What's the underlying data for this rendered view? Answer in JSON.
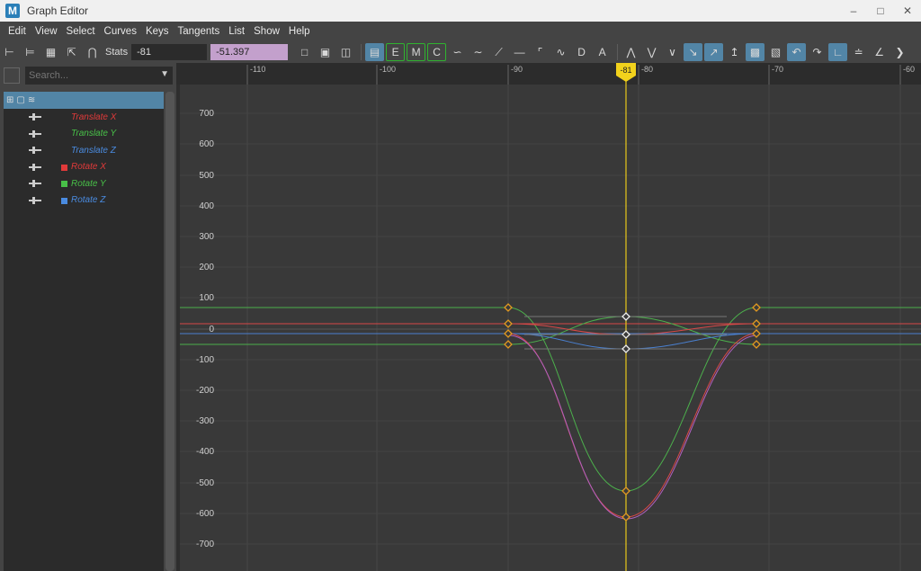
{
  "window": {
    "title": "Graph Editor",
    "logo": "M"
  },
  "menu": [
    "Edit",
    "View",
    "Select",
    "Curves",
    "Keys",
    "Tangents",
    "List",
    "Show",
    "Help"
  ],
  "toolbar": {
    "stats_label": "Stats",
    "stats_frame": "-81",
    "stats_value": "-51.397"
  },
  "outliner": {
    "search_placeholder": "Search...",
    "channels": [
      {
        "label": "Translate X",
        "color": "#e03a3a",
        "swatch": false
      },
      {
        "label": "Translate Y",
        "color": "#48c048",
        "swatch": false
      },
      {
        "label": "Translate Z",
        "color": "#4a8be0",
        "swatch": false
      },
      {
        "label": "Rotate X",
        "color": "#e03a3a",
        "swatch": true
      },
      {
        "label": "Rotate Y",
        "color": "#48c048",
        "swatch": true
      },
      {
        "label": "Rotate Z",
        "color": "#4a8be0",
        "swatch": true
      }
    ]
  },
  "graph": {
    "current_frame": "-81",
    "x_ticks": [
      "-110",
      "-100",
      "-90",
      "-80",
      "-70",
      "-60"
    ],
    "y_ticks": [
      "700",
      "600",
      "500",
      "400",
      "300",
      "200",
      "100",
      "0",
      "-100",
      "-200",
      "-300",
      "-400",
      "-500",
      "-600",
      "-700"
    ],
    "colors": {
      "red": "#d84848",
      "green": "#4cb04c",
      "blue": "#4a80d0",
      "magenta": "#b860b0",
      "key": "#e39a20",
      "time": "#e8c81a"
    }
  }
}
